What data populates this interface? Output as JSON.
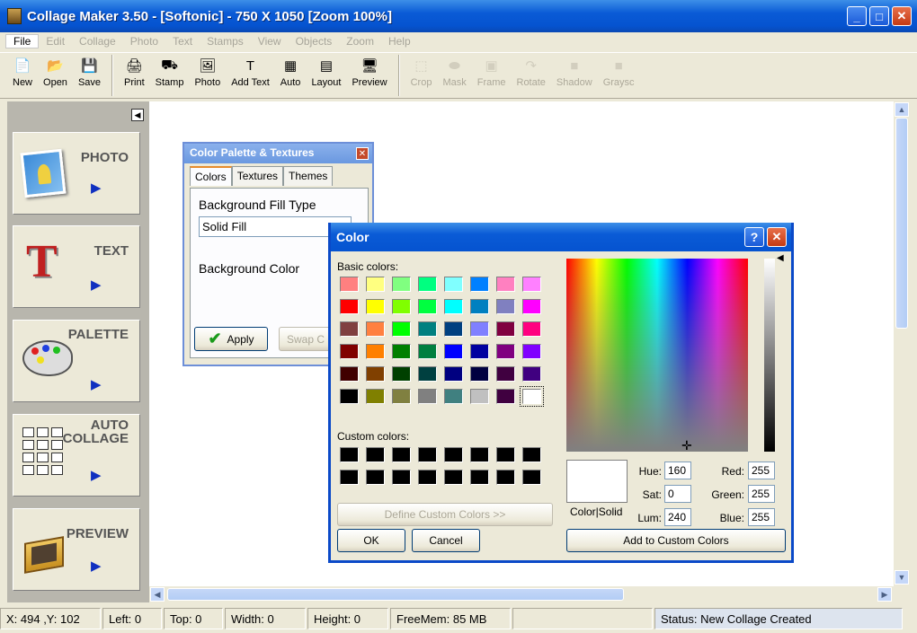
{
  "window": {
    "title": "Collage Maker 3.50  - [Softonic] - 750 X 1050  [Zoom 100%]"
  },
  "menu": [
    "File",
    "Edit",
    "Collage",
    "Photo",
    "Text",
    "Stamps",
    "View",
    "Objects",
    "Zoom",
    "Help"
  ],
  "toolbar": [
    {
      "label": "New",
      "icon": "📄",
      "enabled": true
    },
    {
      "label": "Open",
      "icon": "📂",
      "enabled": true
    },
    {
      "label": "Save",
      "icon": "💾",
      "enabled": true
    },
    {
      "label": "Print",
      "icon": "🖨",
      "enabled": true
    },
    {
      "label": "Stamp",
      "icon": "⛟",
      "enabled": true
    },
    {
      "label": "Photo",
      "icon": "🖼",
      "enabled": true
    },
    {
      "label": "Add Text",
      "icon": "T",
      "enabled": true
    },
    {
      "label": "Auto",
      "icon": "▦",
      "enabled": true
    },
    {
      "label": "Layout",
      "icon": "▤",
      "enabled": true
    },
    {
      "label": "Preview",
      "icon": "🖥",
      "enabled": true
    },
    {
      "label": "Crop",
      "icon": "⬚",
      "enabled": false
    },
    {
      "label": "Mask",
      "icon": "⬬",
      "enabled": false
    },
    {
      "label": "Frame",
      "icon": "▣",
      "enabled": false
    },
    {
      "label": "Rotate",
      "icon": "↷",
      "enabled": false
    },
    {
      "label": "Shadow",
      "icon": "■",
      "enabled": false
    },
    {
      "label": "Graysc",
      "icon": "■",
      "enabled": false
    }
  ],
  "sidebar": [
    {
      "label": "PHOTO"
    },
    {
      "label": "TEXT"
    },
    {
      "label": "PALETTE"
    },
    {
      "label": "AUTO\nCOLLAGE"
    },
    {
      "label": "PREVIEW"
    }
  ],
  "palette": {
    "title": "Color Palette & Textures",
    "tabs": [
      "Colors",
      "Textures",
      "Themes"
    ],
    "fill_type_label": "Background Fill Type",
    "fill_type_value": "Solid Fill",
    "bg_color_label": "Background Color",
    "apply": "Apply",
    "swap": "Swap C"
  },
  "color_dialog": {
    "title": "Color",
    "basic_label": "Basic colors:",
    "custom_label": "Custom colors:",
    "define_btn": "Define Custom Colors >>",
    "ok": "OK",
    "cancel": "Cancel",
    "add_btn": "Add to Custom Colors",
    "colorsolid": "Color|Solid",
    "hue_label": "Hue:",
    "hue": "160",
    "sat_label": "Sat:",
    "sat": "0",
    "lum_label": "Lum:",
    "lum": "240",
    "red_label": "Red:",
    "red": "255",
    "green_label": "Green:",
    "green": "255",
    "blue_label": "Blue:",
    "blue": "255",
    "basic_colors": [
      "#ff8080",
      "#ffff80",
      "#80ff80",
      "#00ff80",
      "#80ffff",
      "#0080ff",
      "#ff80c0",
      "#ff80ff",
      "#ff0000",
      "#ffff00",
      "#80ff00",
      "#00ff40",
      "#00ffff",
      "#0080c0",
      "#8080c0",
      "#ff00ff",
      "#804040",
      "#ff8040",
      "#00ff00",
      "#008080",
      "#004080",
      "#8080ff",
      "#800040",
      "#ff0080",
      "#800000",
      "#ff8000",
      "#008000",
      "#008040",
      "#0000ff",
      "#0000a0",
      "#800080",
      "#8000ff",
      "#400000",
      "#804000",
      "#004000",
      "#004040",
      "#000080",
      "#000040",
      "#400040",
      "#400080",
      "#000000",
      "#808000",
      "#808040",
      "#808080",
      "#408080",
      "#c0c0c0",
      "#400040",
      "#ffffff"
    ]
  },
  "status": {
    "coords": "X: 494 ,Y: 102",
    "left": "Left: 0",
    "top": "Top: 0",
    "width": "Width: 0",
    "height": "Height: 0",
    "freemem": "FreeMem: 85 MB",
    "blank": "",
    "status": "Status: New Collage Created"
  }
}
